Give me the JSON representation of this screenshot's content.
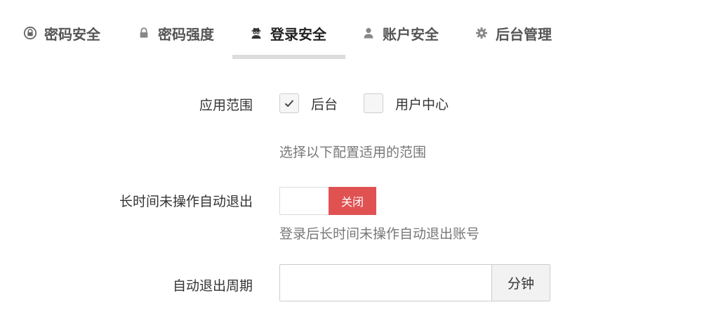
{
  "tabs": [
    {
      "label": "密码安全",
      "icon": "lock-circle-icon"
    },
    {
      "label": "密码强度",
      "icon": "lock-icon"
    },
    {
      "label": "登录安全",
      "icon": "user-secret-icon",
      "active": true
    },
    {
      "label": "账户安全",
      "icon": "user-icon"
    },
    {
      "label": "后台管理",
      "icon": "gear-icon"
    }
  ],
  "form": {
    "scope": {
      "label": "应用范围",
      "options": [
        {
          "label": "后台",
          "checked": true
        },
        {
          "label": "用户中心",
          "checked": false
        }
      ],
      "help": "选择以下配置适用的范围"
    },
    "auto_logout": {
      "label": "长时间未操作自动退出",
      "switch_state_label": "关闭",
      "enabled": false,
      "help": "登录后长时间未操作自动退出账号"
    },
    "logout_period": {
      "label": "自动退出周期",
      "value": "",
      "unit": "分钟"
    }
  },
  "colors": {
    "switch_off_bg": "#e05252",
    "tab_underline": "#dcdcdc",
    "addon_bg": "#f2f2f2"
  }
}
